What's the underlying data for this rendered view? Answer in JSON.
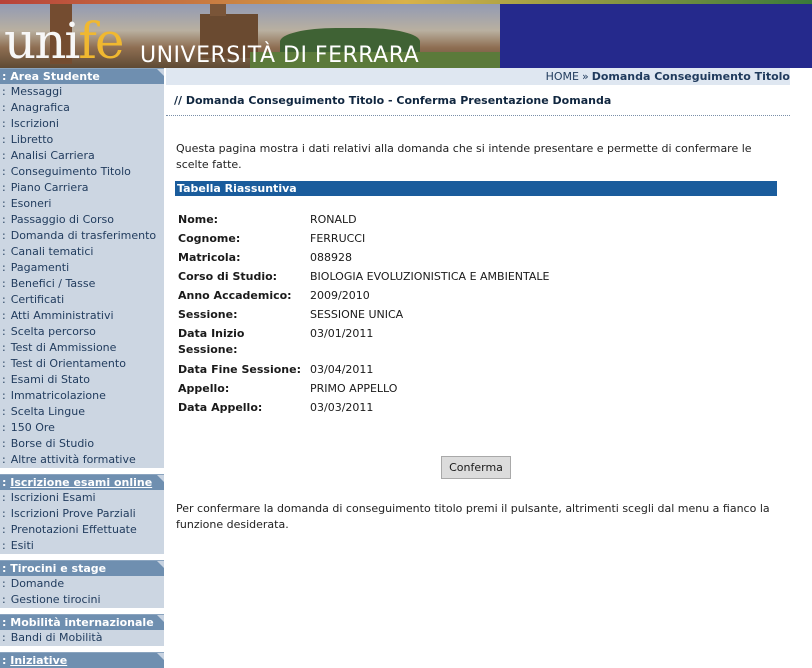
{
  "header": {
    "logo_main": "uni",
    "logo_accent": "fe",
    "university_name": "UNIVERSITÀ DI FERRARA"
  },
  "sidebar": {
    "sections": [
      {
        "title": "Area Studente",
        "items": [
          "Messaggi",
          "Anagrafica",
          "Iscrizioni",
          "Libretto",
          "Analisi Carriera",
          "Conseguimento Titolo",
          "Piano Carriera",
          "Esoneri",
          "Passaggio di Corso",
          "Domanda di trasferimento",
          "Canali tematici",
          "Pagamenti",
          "Benefici / Tasse",
          "Certificati",
          "Atti Amministrativi",
          "Scelta percorso",
          "Test di Ammissione",
          "Test di Orientamento",
          "Esami di Stato",
          "Immatricolazione",
          "Scelta Lingue",
          "150 Ore",
          "Borse di Studio",
          "Altre attività formative"
        ]
      },
      {
        "title": "Iscrizione esami online",
        "items": [
          "Iscrizioni Esami",
          "Iscrizioni Prove Parziali",
          "Prenotazioni Effettuate",
          "Esiti"
        ]
      },
      {
        "title": "Tirocini e stage",
        "items": [
          "Domande",
          "Gestione tirocini"
        ]
      },
      {
        "title": "Mobilità internazionale",
        "items": [
          "Bandi di Mobilità"
        ]
      },
      {
        "title": "Iniziative",
        "items": []
      }
    ],
    "bullet": ":"
  },
  "breadcrumb": {
    "home": "HOME",
    "separator": "»",
    "current": "Domanda Conseguimento Titolo"
  },
  "page_title": "// Domanda Conseguimento Titolo - Conferma Presentazione Domanda",
  "intro_text": "Questa pagina mostra i dati relativi alla domanda che si intende presentare e permette di confermare le scelte fatte.",
  "summary": {
    "heading": "Tabella Riassuntiva",
    "rows": [
      {
        "label": "Nome:",
        "value": "RONALD"
      },
      {
        "label": "Cognome:",
        "value": "FERRUCCI"
      },
      {
        "label": "Matricola:",
        "value": "088928"
      },
      {
        "label": "Corso di Studio:",
        "value": "BIOLOGIA EVOLUZIONISTICA E AMBIENTALE"
      },
      {
        "label": "Anno Accademico:",
        "value": "2009/2010"
      },
      {
        "label": "Sessione:",
        "value": "SESSIONE UNICA"
      },
      {
        "label": "Data Inizio Sessione:",
        "value": "03/01/2011"
      },
      {
        "label": "Data Fine Sessione:",
        "value": "03/04/2011"
      },
      {
        "label": "Appello:",
        "value": "PRIMO APPELLO"
      },
      {
        "label": "Data Appello:",
        "value": "03/03/2011"
      }
    ]
  },
  "confirm_button": "Conferma",
  "footer_note": "Per confermare la domanda di conseguimento titolo premi il pulsante, altrimenti scegli dal menu a fianco la funzione desiderata.",
  "colors": {
    "banner_blue": "#25298c",
    "sidebar_bg": "#ccd6e2",
    "section_header": "#6f8fb0",
    "table_header": "#1a5c9c",
    "breadcrumb_bg": "#dfe7f1",
    "logo_accent": "#f0b830"
  }
}
